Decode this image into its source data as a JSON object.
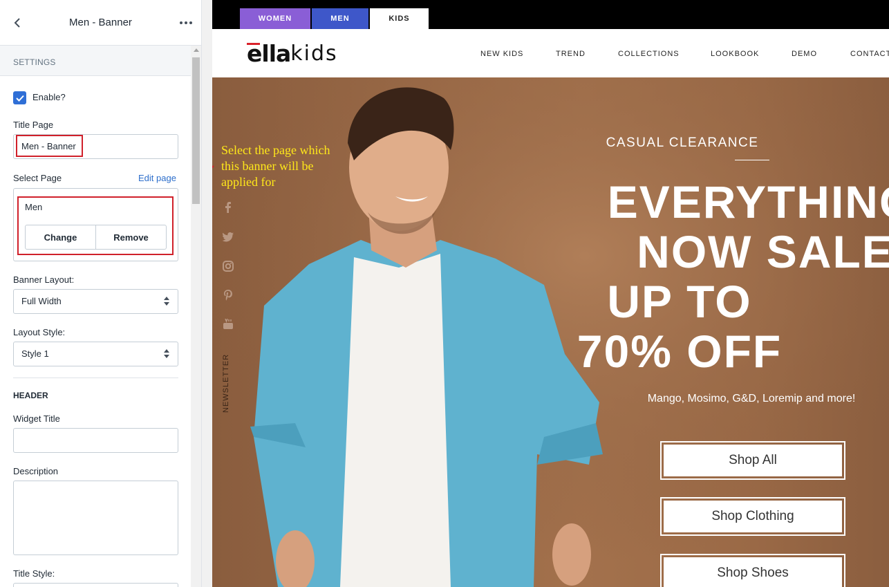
{
  "panel": {
    "title": "Men - Banner",
    "section_label": "SETTINGS",
    "enable_label": "Enable?",
    "enable_checked": true,
    "title_page_label": "Title Page",
    "title_page_value": "Men - Banner",
    "select_page_label": "Select Page",
    "edit_page_link": "Edit page",
    "selected_page": "Men",
    "change_button": "Change",
    "remove_button": "Remove",
    "banner_layout_label": "Banner Layout:",
    "banner_layout_value": "Full Width",
    "layout_style_label": "Layout Style:",
    "layout_style_value": "Style 1",
    "header_heading": "HEADER",
    "widget_title_label": "Widget Title",
    "widget_title_value": "",
    "description_label": "Description",
    "description_value": "",
    "title_style_label": "Title Style:"
  },
  "annotation": {
    "text": "Select the page which this banner will be applied for",
    "color": "#ffe81a",
    "highlight_color": "#d0202a"
  },
  "store": {
    "tabs": [
      {
        "label": "WOMEN",
        "color": "#8a5ed6"
      },
      {
        "label": "MEN",
        "color": "#3e57c9"
      },
      {
        "label": "KIDS",
        "color": "#ffffff"
      }
    ],
    "logo": {
      "bold": "ella",
      "light": "kids"
    },
    "nav": [
      "NEW KIDS",
      "TREND",
      "COLLECTIONS",
      "LOOKBOOK",
      "DEMO",
      "CONTACT"
    ],
    "social_icons": [
      "facebook-icon",
      "twitter-icon",
      "instagram-icon",
      "pinterest-icon",
      "youtube-icon"
    ],
    "newsletter": "NEWSLETTER"
  },
  "hero": {
    "kicker": "CASUAL CLEARANCE",
    "headline_lines": [
      "EVERYTHING",
      "NOW SALE",
      "UP TO",
      "70% OFF"
    ],
    "brands": "Mango, Mosimo, G&D, Loremip and more!",
    "buttons": [
      "Shop All",
      "Shop Clothing",
      "Shop Shoes"
    ],
    "background": "#9b6a47"
  }
}
